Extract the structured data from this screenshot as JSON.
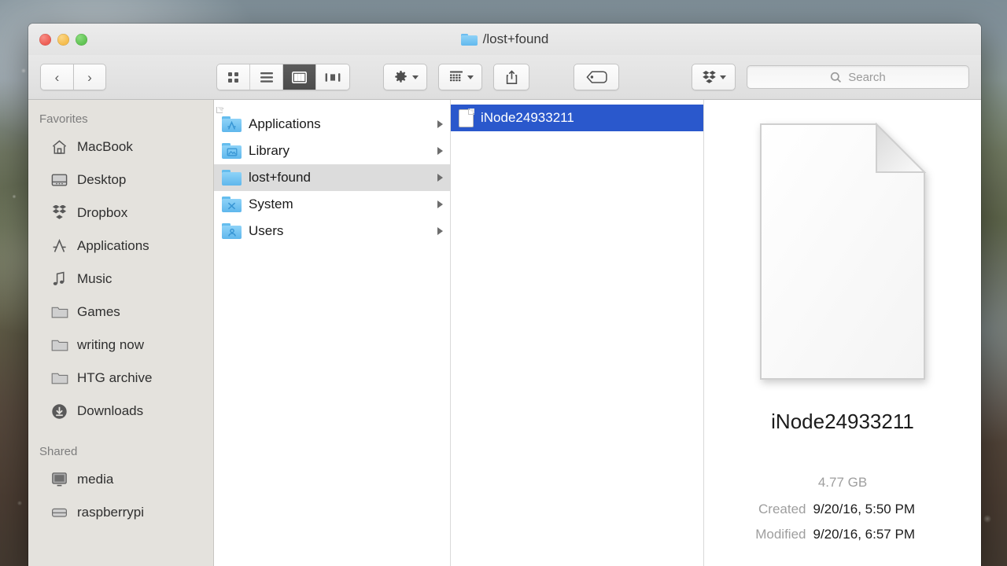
{
  "window": {
    "title": "/lost+found",
    "title_icon": "folder-icon",
    "traffic_lights": [
      {
        "name": "close-button",
        "color": "#ee5f56"
      },
      {
        "name": "minimize-button",
        "color": "#f5bd4f"
      },
      {
        "name": "maximize-button",
        "color": "#61c454"
      }
    ]
  },
  "toolbar": {
    "back_label": "‹",
    "forward_label": "›",
    "view_modes": [
      {
        "name": "icon-view",
        "active": false
      },
      {
        "name": "list-view",
        "active": false
      },
      {
        "name": "column-view",
        "active": true
      },
      {
        "name": "coverflow-view",
        "active": false
      }
    ],
    "action_button": "gear-icon",
    "arrange_button": "arrange-icon",
    "share_button": "share-icon",
    "tag_button": "tag-icon",
    "dropbox_button": "dropbox-icon",
    "search": {
      "placeholder": "Search",
      "value": "Search"
    }
  },
  "sidebar": {
    "sections": [
      {
        "header": "Favorites",
        "items": [
          {
            "label": "MacBook",
            "icon": "home-icon"
          },
          {
            "label": "Desktop",
            "icon": "desktop-icon"
          },
          {
            "label": "Dropbox",
            "icon": "dropbox-icon"
          },
          {
            "label": "Applications",
            "icon": "applications-icon"
          },
          {
            "label": "Music",
            "icon": "music-note-icon"
          },
          {
            "label": "Games",
            "icon": "folder-icon"
          },
          {
            "label": "writing now",
            "icon": "folder-icon"
          },
          {
            "label": "HTG archive",
            "icon": "folder-icon"
          },
          {
            "label": "Downloads",
            "icon": "downloads-icon"
          }
        ]
      },
      {
        "header": "Shared",
        "items": [
          {
            "label": "media",
            "icon": "display-icon"
          },
          {
            "label": "raspberrypi",
            "icon": "server-icon"
          }
        ]
      }
    ]
  },
  "columns": {
    "nav": {
      "items": [
        {
          "label": "Applications",
          "icon": "folder-applications-icon",
          "selected": false,
          "has_children": true
        },
        {
          "label": "Library",
          "icon": "folder-library-icon",
          "selected": false,
          "has_children": true
        },
        {
          "label": "lost+found",
          "icon": "folder-icon",
          "selected": true,
          "has_children": true
        },
        {
          "label": "System",
          "icon": "folder-system-icon",
          "selected": false,
          "has_children": true
        },
        {
          "label": "Users",
          "icon": "folder-users-icon",
          "selected": false,
          "has_children": true
        }
      ]
    },
    "files": {
      "items": [
        {
          "label": "iNode24933211",
          "icon": "document-icon",
          "selected": true
        }
      ]
    }
  },
  "preview": {
    "icon": "document-icon",
    "name": "iNode24933211",
    "size": "4.77 GB",
    "details": [
      {
        "key": "Created",
        "value": "9/20/16, 5:50 PM"
      },
      {
        "key": "Modified",
        "value": "9/20/16, 6:57 PM"
      }
    ]
  },
  "colors": {
    "selection_blue": "#2a58cc",
    "selection_gray": "#dcdcdc",
    "folder_blue": "#5fb7ec",
    "sidebar_bg": "#e4e2dd"
  }
}
